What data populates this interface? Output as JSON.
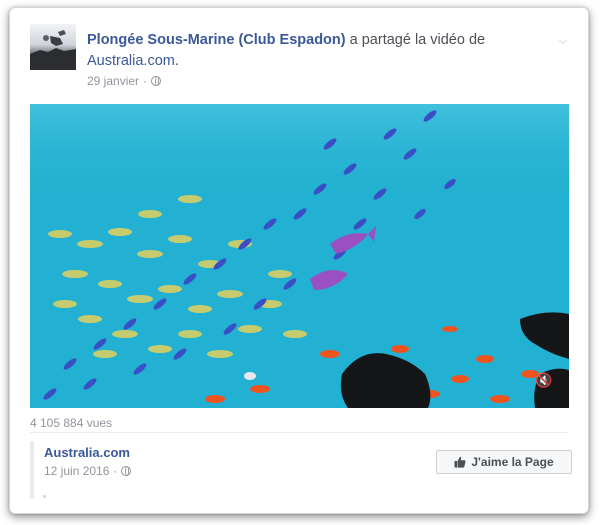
{
  "post": {
    "author": "Plongée Sous-Marine (Club Espadon)",
    "action_text": " a partagé la vidéo de ",
    "shared_from": "Australia.com",
    "period": ".",
    "date": "29 janvier",
    "separator": "·",
    "privacy_icon": "globe-icon",
    "menu_icon": "chevron-down-icon"
  },
  "video": {
    "description_icon": "mute-icon",
    "mute_glyph": "🔇",
    "views": "4 105 884 vues"
  },
  "shared_page": {
    "name": "Australia.com",
    "date": "12 juin 2016",
    "separator": "·",
    "like_button_label": "J'aime la Page",
    "like_icon": "thumbs-up-icon"
  },
  "colors": {
    "link": "#3b5998",
    "meta": "#90949c",
    "text": "#4b4f56",
    "water": "#1ca9cc"
  }
}
